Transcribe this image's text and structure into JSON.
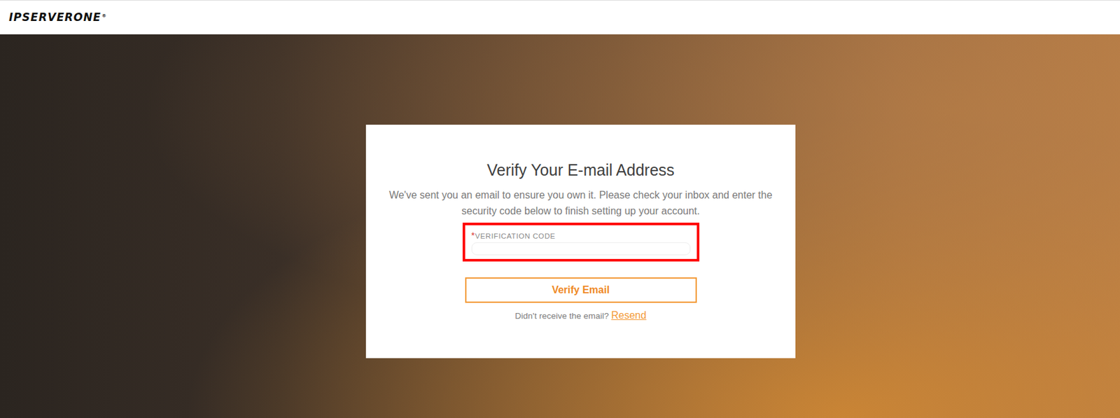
{
  "header": {
    "logo": "IPSERVERONE",
    "logo_mark": "®"
  },
  "card": {
    "title": "Verify Your E-mail Address",
    "message": "We've sent you an email to ensure you own it. Please check your inbox and enter the security code below to finish setting up your account.",
    "field": {
      "required_mark": "*",
      "label": "VERIFICATION CODE",
      "highlighted": true
    },
    "button": "Verify Email",
    "resend": {
      "prompt": "Didn't receive the email?",
      "link": "Resend"
    }
  }
}
